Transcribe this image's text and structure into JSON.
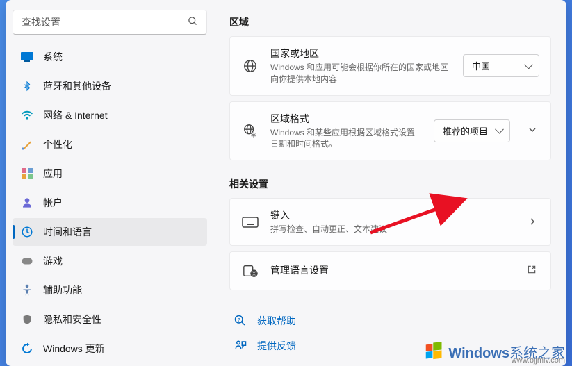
{
  "search": {
    "placeholder": "查找设置"
  },
  "nav": {
    "items": [
      {
        "label": "系统",
        "icon": "system",
        "color": "#0078d4"
      },
      {
        "label": "蓝牙和其他设备",
        "icon": "bluetooth",
        "color": "#0078d4"
      },
      {
        "label": "网络 & Internet",
        "icon": "wifi",
        "color": "#0099bc"
      },
      {
        "label": "个性化",
        "icon": "brush",
        "color": "#e8a33d"
      },
      {
        "label": "应用",
        "icon": "apps",
        "color": "#e06b8b"
      },
      {
        "label": "帐户",
        "icon": "account",
        "color": "#6b69d6"
      },
      {
        "label": "时间和语言",
        "icon": "clock-globe",
        "color": "#0078d4",
        "active": true
      },
      {
        "label": "游戏",
        "icon": "gamepad",
        "color": "#888888"
      },
      {
        "label": "辅助功能",
        "icon": "accessibility",
        "color": "#5a7fb0"
      },
      {
        "label": "隐私和安全性",
        "icon": "shield",
        "color": "#7a7a7a"
      },
      {
        "label": "Windows 更新",
        "icon": "update",
        "color": "#0078d4"
      }
    ]
  },
  "sections": {
    "region": {
      "title": "区域",
      "country": {
        "title": "国家或地区",
        "desc": "Windows 和应用可能会根据你所在的国家或地区向你提供本地内容",
        "value": "中国"
      },
      "format": {
        "title": "区域格式",
        "desc": "Windows 和某些应用根据区域格式设置日期和时间格式。",
        "value": "推荐的项目"
      }
    },
    "related": {
      "title": "相关设置",
      "typing": {
        "title": "键入",
        "desc": "拼写检查、自动更正、文本建议"
      },
      "adminLang": {
        "title": "管理语言设置"
      }
    },
    "help": {
      "getHelp": "获取帮助",
      "feedback": "提供反馈"
    }
  },
  "watermark": {
    "brand": "Windows",
    "suffix": "系统之家",
    "url": "www.bjjmlv.com"
  }
}
